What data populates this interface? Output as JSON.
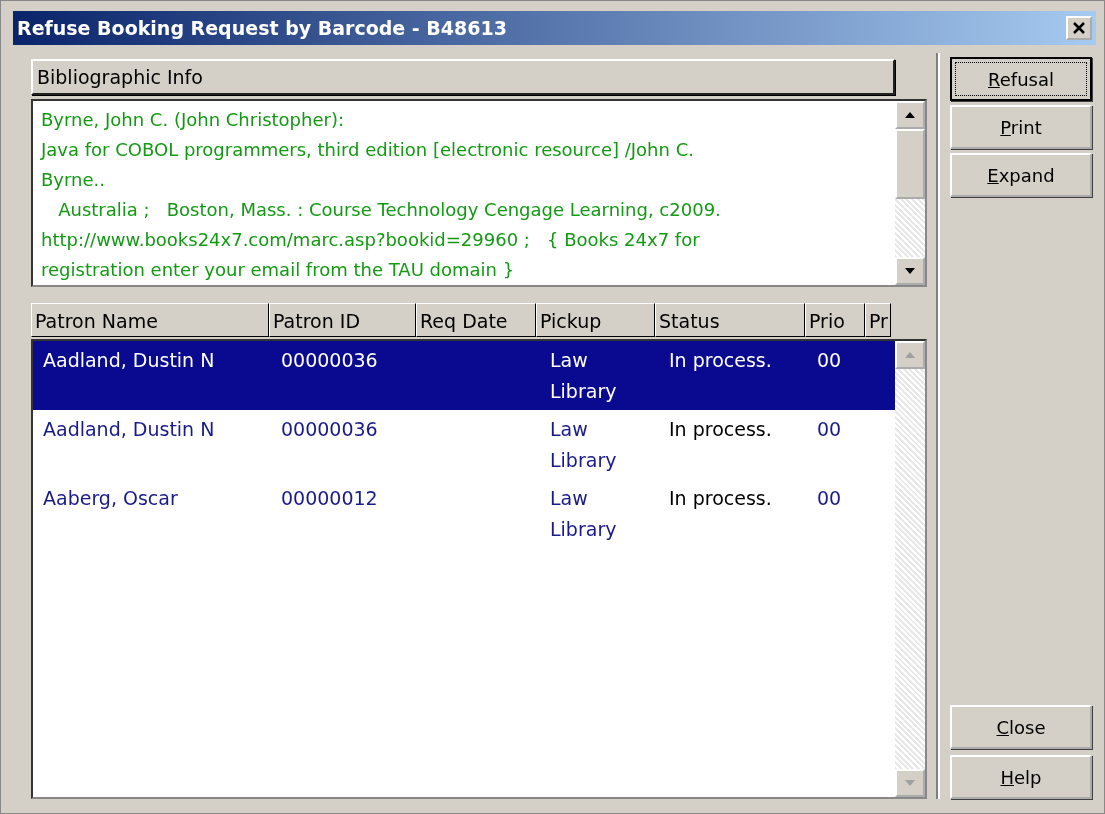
{
  "window": {
    "title": "Refuse Booking Request by Barcode - B48613"
  },
  "bibliographic_info": {
    "heading": "Bibliographic Info",
    "lines": [
      "Byrne, John C. (John Christopher):",
      "Java for COBOL programmers, third edition [electronic resource] /John C.",
      "Byrne..",
      "   Australia ;   Boston, Mass. : Course Technology Cengage Learning, c2009.",
      "http://www.books24x7.com/marc.asp?bookid=29960 ;   { Books 24x7 for",
      "registration enter your email from the TAU domain }"
    ]
  },
  "table": {
    "columns": [
      "Patron Name",
      "Patron ID",
      "Req Date",
      "Pickup",
      "Status",
      "Prio",
      "Pr"
    ],
    "rows": [
      {
        "patron_name": "Aadland, Dustin N",
        "patron_id": "00000036",
        "pickup": "Law Library",
        "status": "In process.",
        "priority": "00",
        "selected": true
      },
      {
        "patron_name": "Aadland, Dustin N",
        "patron_id": "00000036",
        "pickup": "Law Library",
        "status": "In process.",
        "priority": "00",
        "selected": false
      },
      {
        "patron_name": "Aaberg, Oscar",
        "patron_id": "00000012",
        "pickup": "Law Library",
        "status": "In process.",
        "priority": "00",
        "selected": false
      }
    ]
  },
  "buttons": [
    {
      "label": "Refusal",
      "focused": true
    },
    {
      "label": "Print",
      "focused": false
    },
    {
      "label": "Expand",
      "focused": false
    }
  ],
  "bottom_buttons": [
    {
      "label": "Close",
      "focused": false
    },
    {
      "label": "Help",
      "focused": false
    }
  ]
}
